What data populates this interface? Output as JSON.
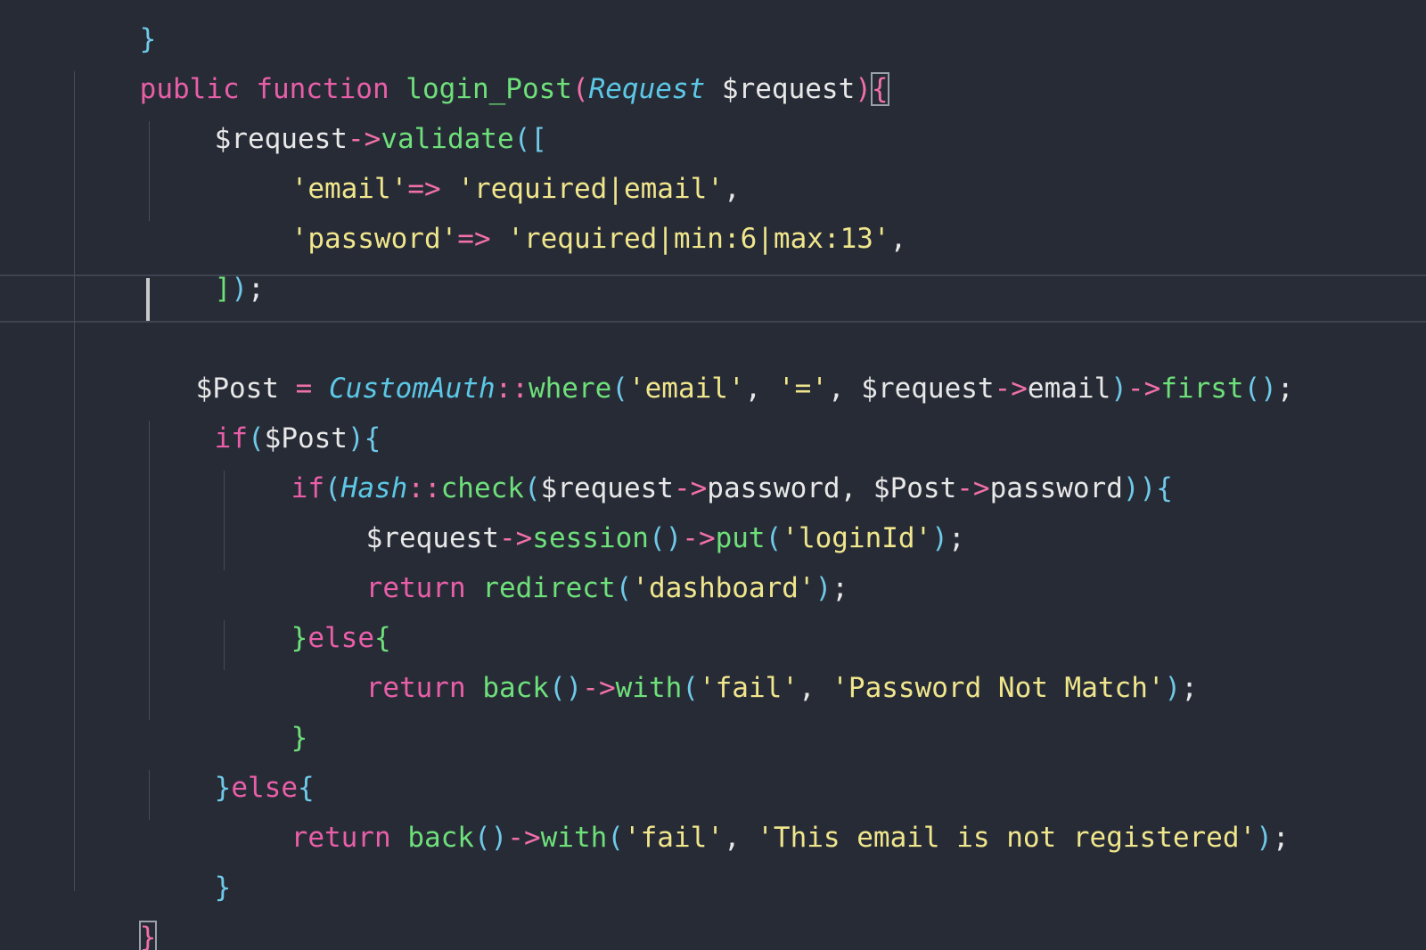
{
  "colors": {
    "background": "#272b36",
    "keyword": "#e85fa8",
    "function": "#6ee07a",
    "class": "#5cc8e6",
    "string": "#f0e68c",
    "operator": "#f070a8",
    "punctuation": "#6fc9e8",
    "variable": "#e8e8e8"
  },
  "code": {
    "l0": {
      "t0": "}"
    },
    "l1": {
      "t0": "public",
      "t1": " ",
      "t2": "function",
      "t3": " ",
      "t4": "login_Post",
      "t5": "(",
      "t6": "Request",
      "t7": " $request",
      "t8": ")",
      "t9": "{"
    },
    "l2": {
      "t0": "$request",
      "t1": "->",
      "t2": "validate",
      "t3": "(["
    },
    "l3": {
      "t0": "'email'",
      "t1": "=>",
      "t2": " ",
      "t3": "'required|email'",
      "t4": ","
    },
    "l4": {
      "t0": "'password'",
      "t1": "=>",
      "t2": " ",
      "t3": "'required|min:6|max:13'",
      "t4": ","
    },
    "l5": {
      "t0": "]",
      "t1": ")",
      "t2": ";"
    },
    "l6": {
      "t0": "$Post",
      "t1": " ",
      "t2": "=",
      "t3": " ",
      "t4": "CustomAuth",
      "t5": "::",
      "t6": "where",
      "t7": "(",
      "t8": "'email'",
      "t9": ", ",
      "t10": "'='",
      "t11": ", ",
      "t12": "$request",
      "t13": "->",
      "t14": "email",
      "t15": ")",
      "t16": "->",
      "t17": "first",
      "t18": "()",
      "t19": ";"
    },
    "l7": {
      "t0": "if",
      "t1": "(",
      "t2": "$Post",
      "t3": "){"
    },
    "l8": {
      "t0": "if",
      "t1": "(",
      "t2": "Hash",
      "t3": "::",
      "t4": "check",
      "t5": "(",
      "t6": "$request",
      "t7": "->",
      "t8": "password",
      "t9": ", ",
      "t10": "$Post",
      "t11": "->",
      "t12": "password",
      "t13": ")){"
    },
    "l9": {
      "t0": "$request",
      "t1": "->",
      "t2": "session",
      "t3": "()",
      "t4": "->",
      "t5": "put",
      "t6": "(",
      "t7": "'loginId'",
      "t8": ")",
      "t9": ";"
    },
    "l10": {
      "t0": "return",
      "t1": " ",
      "t2": "redirect",
      "t3": "(",
      "t4": "'dashboard'",
      "t5": ")",
      "t6": ";"
    },
    "l11": {
      "t0": "}",
      "t1": "else",
      "t2": "{"
    },
    "l12": {
      "t0": "return",
      "t1": " ",
      "t2": "back",
      "t3": "()",
      "t4": "->",
      "t5": "with",
      "t6": "(",
      "t7": "'fail'",
      "t8": ", ",
      "t9": "'Password Not Match'",
      "t10": ")",
      "t11": ";"
    },
    "l13": {
      "t0": "}"
    },
    "l14": {
      "t0": "}",
      "t1": "else",
      "t2": "{"
    },
    "l15": {
      "t0": "return",
      "t1": " ",
      "t2": "back",
      "t3": "()",
      "t4": "->",
      "t5": "with",
      "t6": "(",
      "t7": "'fail'",
      "t8": ", ",
      "t9": "'This email is not registered'",
      "t10": ")",
      "t11": ";"
    },
    "l16": {
      "t0": "}"
    },
    "l17": {
      "t0": "}"
    }
  }
}
